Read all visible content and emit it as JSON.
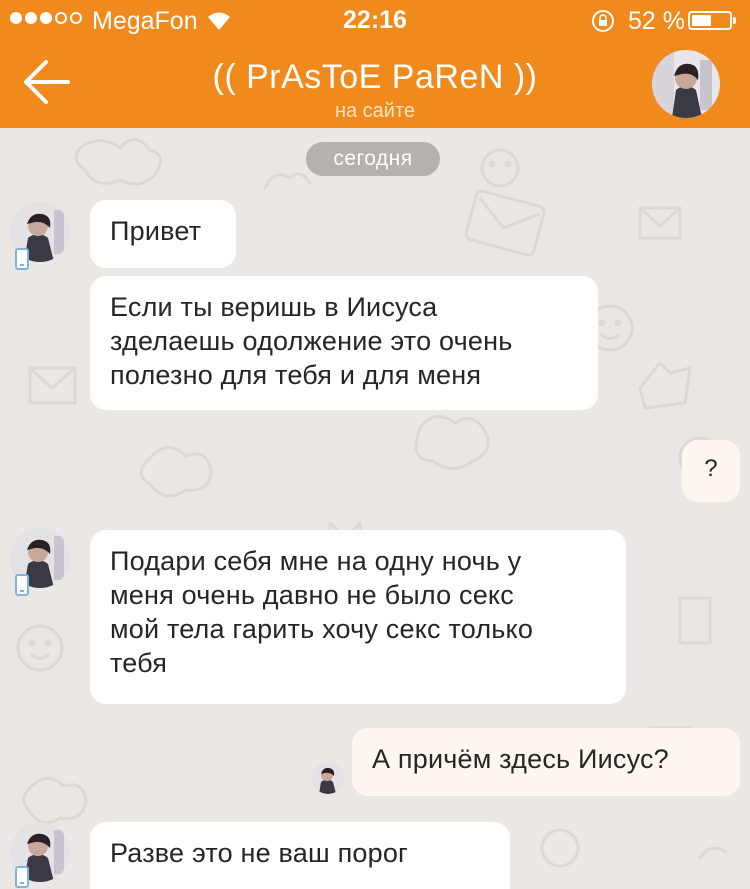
{
  "status_bar": {
    "carrier": "MegaFon",
    "time": "22:16",
    "battery_percent": "52 %",
    "battery_level": 0.52
  },
  "header": {
    "title": "(( PrAsToE PaReN ))",
    "subtitle": "на сайте"
  },
  "date_separator": "сегодня",
  "messages": [
    {
      "direction": "in",
      "text": "Привет"
    },
    {
      "direction": "in",
      "line1": "Если ты веришь в Иисуса",
      "line2": "зделаешь одолжение это очень",
      "line3": "полезно для тебя и для меня"
    },
    {
      "direction": "out",
      "text": "?"
    },
    {
      "direction": "in",
      "line1": "Подари себя мне на одну ночь у",
      "line2": "меня очень давно не было секс",
      "line3": "мой тела гарить хочу секс только",
      "line4": "тебя"
    },
    {
      "direction": "out",
      "text": "А причём здесь Иисус?"
    },
    {
      "direction": "in",
      "text": "Разве это не ваш порог"
    }
  ],
  "colors": {
    "header_bg": "#f08a1c",
    "chat_bg": "#ebe7e4",
    "incoming_bubble": "#ffffff",
    "outgoing_bubble": "#fdf7ef",
    "date_badge": "#b5b1ae"
  }
}
